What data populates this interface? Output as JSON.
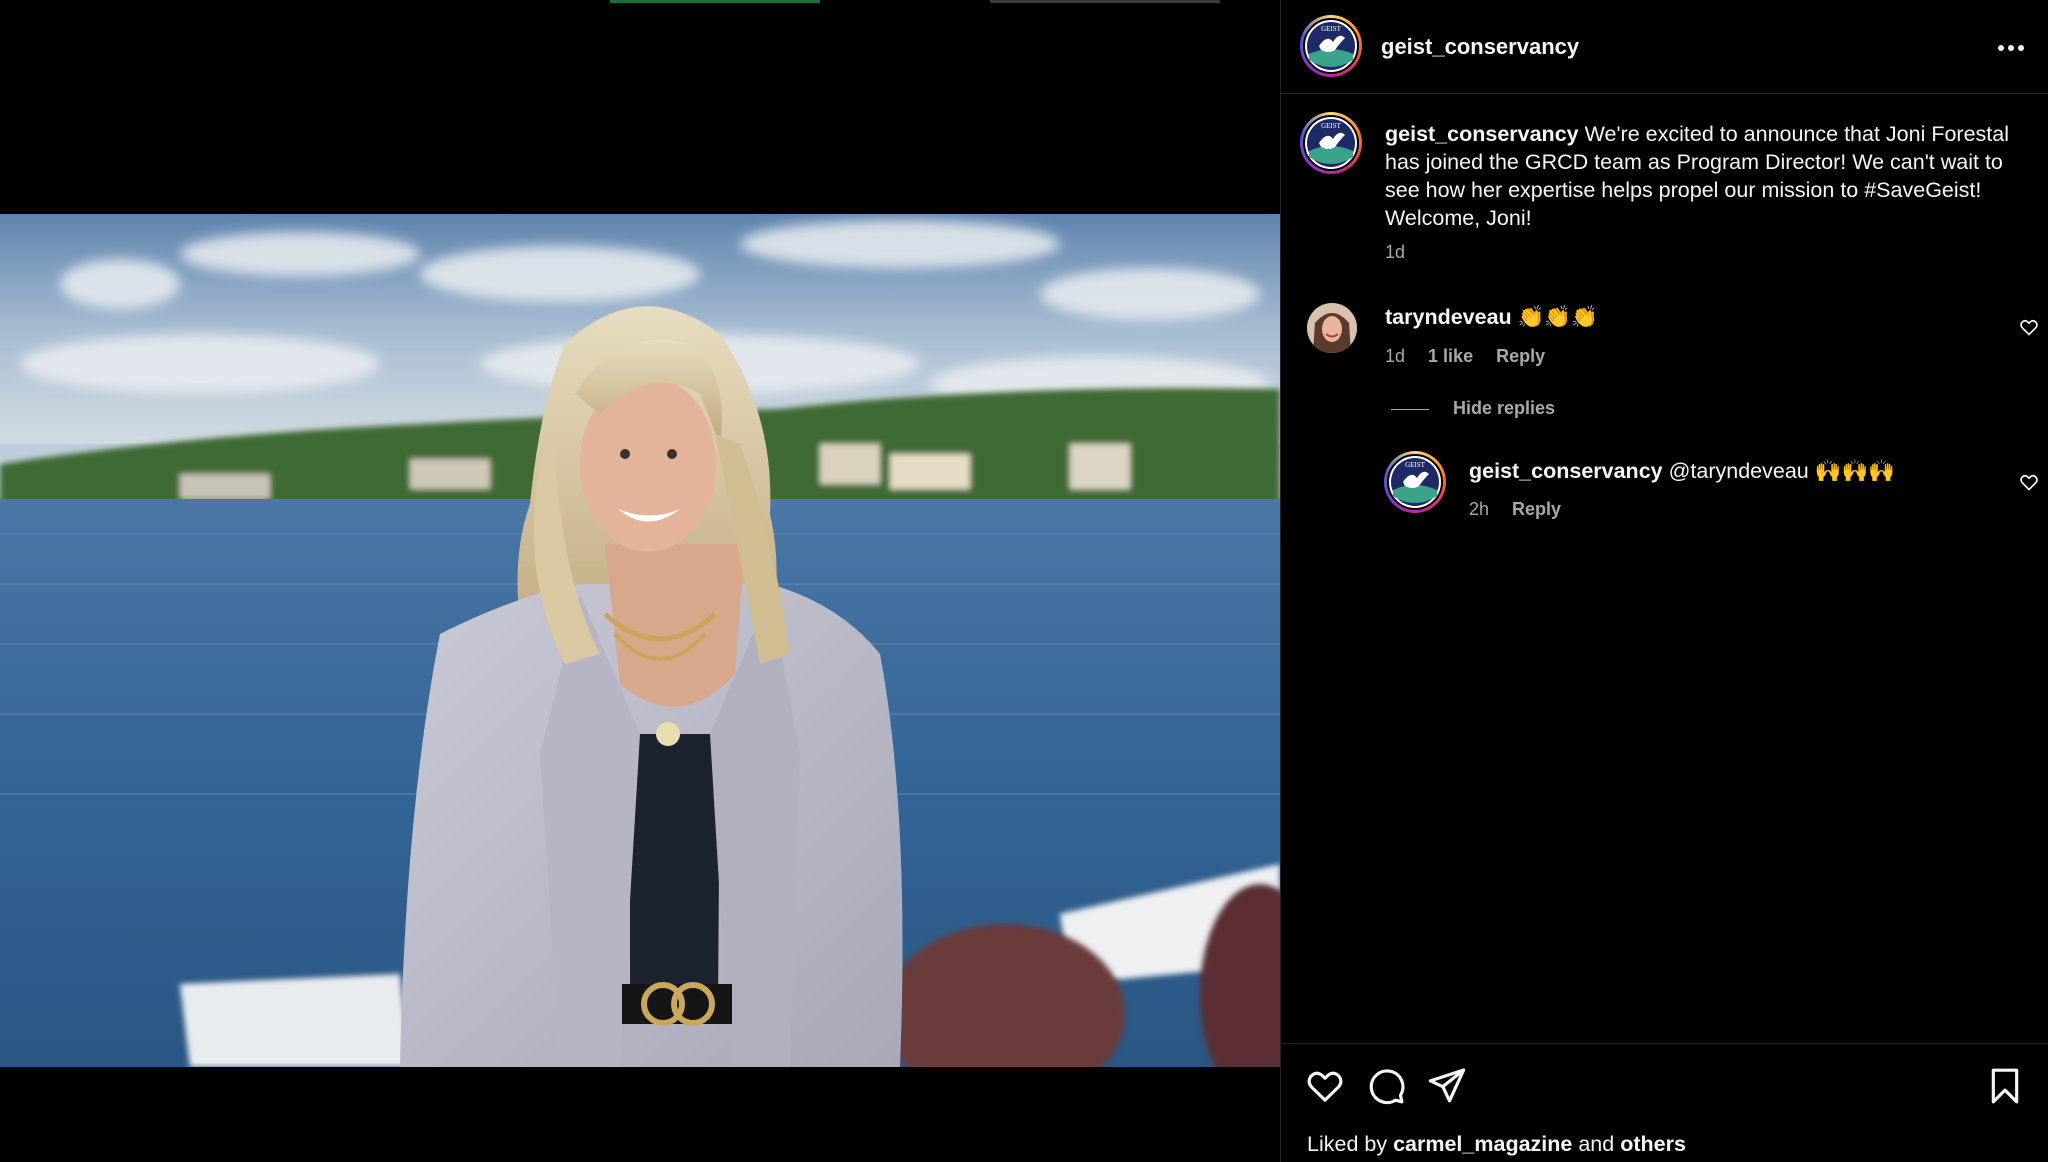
{
  "post": {
    "author": "geist_conservancy",
    "more_icon": "more-horizontal-icon"
  },
  "caption": {
    "username": "geist_conservancy",
    "text": "We're excited to announce that Joni Forestal has joined the GRCD team as Program Director! We can't wait to see how her expertise helps propel our mission to #SaveGeist! Welcome, Joni!",
    "time": "1d"
  },
  "comments": [
    {
      "username": "taryndeveau",
      "text": "👏👏👏",
      "time": "1d",
      "likes": "1 like",
      "reply_label": "Reply",
      "hide_replies_label": "Hide replies",
      "replies": [
        {
          "username": "geist_conservancy",
          "text": "@taryndeveau 🙌🙌🙌",
          "time": "2h",
          "reply_label": "Reply"
        }
      ]
    }
  ],
  "liked_by": {
    "prefix": "Liked by",
    "user": "carmel_magazine",
    "conjunction": "and",
    "others": "others"
  },
  "colors": {
    "background": "#000000",
    "text": "#f5f5f5",
    "secondary_text": "#a8a8a8",
    "divider": "#262626"
  }
}
